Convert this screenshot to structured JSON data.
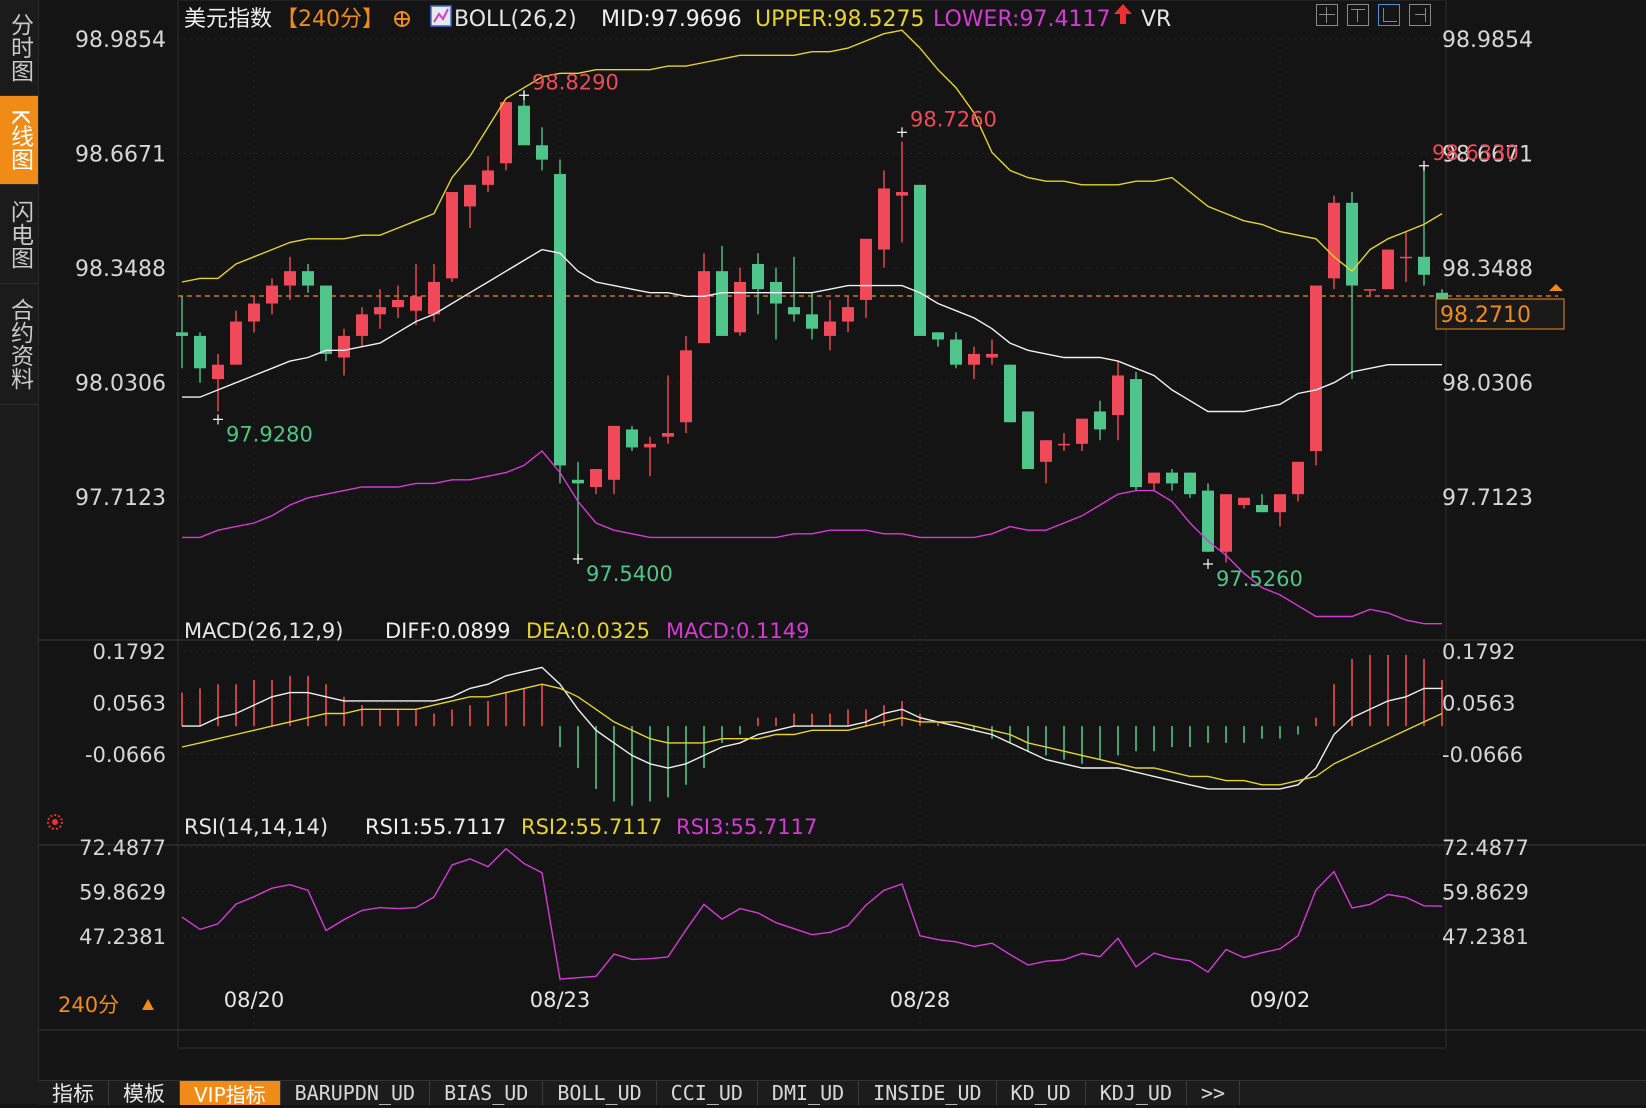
{
  "nav": [
    {
      "label": "分时图",
      "active": false
    },
    {
      "label": "K线图",
      "active": true
    },
    {
      "label": "闪电图",
      "active": false
    },
    {
      "label": "合约资料",
      "active": false
    }
  ],
  "header": {
    "instrument": "美元指数",
    "period": "【240分】",
    "boll": "BOLL(26,2)",
    "mid": "MID:97.9696",
    "upper": "UPPER:98.5275",
    "lower": "LOWER:97.4117",
    "vr": "VR"
  },
  "main_axis": {
    "ticks": [
      "98.9854",
      "98.6671",
      "98.3488",
      "98.0306",
      "97.7123"
    ],
    "tick_values": [
      98.9854,
      98.6671,
      98.3488,
      98.0306,
      97.7123
    ],
    "current_price": "98.2710",
    "current_value": 98.271
  },
  "annotations": [
    {
      "text": "98.8290",
      "kind": "high"
    },
    {
      "text": "98.7260",
      "kind": "high"
    },
    {
      "text": "98.6330",
      "kind": "high"
    },
    {
      "text": "97.9280",
      "kind": "low"
    },
    {
      "text": "97.5400",
      "kind": "low"
    },
    {
      "text": "97.5260",
      "kind": "low"
    }
  ],
  "macd": {
    "label": "MACD(26,12,9)",
    "diff": "DIFF:0.0899",
    "dea": "DEA:0.0325",
    "macd": "MACD:0.1149",
    "ticks": [
      "0.1792",
      "0.0563",
      "-0.0666"
    ],
    "tick_values": [
      0.1792,
      0.0563,
      -0.0666
    ]
  },
  "rsi": {
    "label": "RSI(14,14,14)",
    "rsi1": "RSI1:55.7117",
    "rsi2": "RSI2:55.7117",
    "rsi3": "RSI3:55.7117",
    "ticks": [
      "72.4877",
      "59.8629",
      "47.2381"
    ],
    "tick_values": [
      72.4877,
      59.8629,
      47.2381
    ]
  },
  "x_axis": {
    "period_label": "240分",
    "dates": [
      "08/20",
      "08/23",
      "08/28",
      "09/02"
    ]
  },
  "tabs": [
    "指标",
    "模板",
    "VIP指标",
    "BARUPDN_UD",
    "BIAS_UD",
    "BOLL_UD",
    "CCI_UD",
    "DMI_UD",
    "INSIDE_UD",
    "KD_UD",
    "KDJ_UD",
    ">>"
  ],
  "colors": {
    "up": "#f04a5a",
    "down": "#4fc48b",
    "mid": "#f0f0f0",
    "upper": "#e6d32c",
    "lower": "#d63ad6",
    "accent": "#f08b17",
    "high_label": "#f04a5a",
    "low_label": "#4fc48b"
  },
  "chart_data": {
    "type": "candlestick",
    "candles": [
      [
        98.17,
        98.27,
        98.07,
        98.16
      ],
      [
        98.16,
        98.17,
        98.03,
        98.07
      ],
      [
        98.04,
        98.11,
        97.95,
        98.08
      ],
      [
        98.08,
        98.23,
        98.08,
        98.2
      ],
      [
        98.2,
        98.27,
        98.17,
        98.25
      ],
      [
        98.25,
        98.32,
        98.22,
        98.3
      ],
      [
        98.3,
        98.38,
        98.26,
        98.34
      ],
      [
        98.34,
        98.36,
        98.28,
        98.3
      ],
      [
        98.3,
        98.3,
        98.09,
        98.11
      ],
      [
        98.1,
        98.18,
        98.05,
        98.16
      ],
      [
        98.16,
        98.24,
        98.13,
        98.22
      ],
      [
        98.22,
        98.29,
        98.18,
        98.24
      ],
      [
        98.24,
        98.3,
        98.21,
        98.26
      ],
      [
        98.23,
        98.36,
        98.19,
        98.27
      ],
      [
        98.22,
        98.36,
        98.2,
        98.31
      ],
      [
        98.32,
        98.55,
        98.31,
        98.56
      ],
      [
        98.52,
        98.58,
        98.46,
        98.58
      ],
      [
        98.58,
        98.66,
        98.56,
        98.62
      ],
      [
        98.64,
        98.81,
        98.62,
        98.81
      ],
      [
        98.8,
        98.84,
        98.7,
        98.69
      ],
      [
        98.69,
        98.74,
        98.62,
        98.65
      ],
      [
        98.61,
        98.65,
        97.75,
        97.8
      ],
      [
        97.76,
        97.81,
        97.54,
        97.75
      ],
      [
        97.74,
        97.79,
        97.72,
        97.79
      ],
      [
        97.76,
        97.89,
        97.72,
        97.91
      ],
      [
        97.9,
        97.91,
        97.84,
        97.85
      ],
      [
        97.85,
        97.88,
        97.77,
        97.86
      ],
      [
        97.88,
        98.05,
        97.86,
        97.89
      ],
      [
        97.92,
        98.16,
        97.89,
        98.12
      ],
      [
        98.14,
        98.39,
        98.14,
        98.34
      ],
      [
        98.34,
        98.41,
        98.16,
        98.16
      ],
      [
        98.17,
        98.35,
        98.16,
        98.31
      ],
      [
        98.36,
        98.39,
        98.22,
        98.29
      ],
      [
        98.31,
        98.35,
        98.15,
        98.25
      ],
      [
        98.24,
        98.38,
        98.2,
        98.22
      ],
      [
        98.22,
        98.28,
        98.15,
        98.18
      ],
      [
        98.16,
        98.26,
        98.12,
        98.2
      ],
      [
        98.2,
        98.27,
        98.17,
        98.24
      ],
      [
        98.26,
        98.37,
        98.21,
        98.43
      ],
      [
        98.4,
        98.62,
        98.35,
        98.57
      ],
      [
        98.55,
        98.7,
        98.42,
        98.56
      ],
      [
        98.58,
        98.58,
        98.16,
        98.16
      ],
      [
        98.17,
        98.17,
        98.13,
        98.15
      ],
      [
        98.15,
        98.17,
        98.07,
        98.08
      ],
      [
        98.08,
        98.13,
        98.04,
        98.11
      ],
      [
        98.1,
        98.15,
        98.08,
        98.11
      ],
      [
        98.08,
        98.08,
        97.92,
        97.92
      ],
      [
        97.95,
        97.95,
        97.79,
        97.79
      ],
      [
        97.81,
        97.87,
        97.75,
        97.87
      ],
      [
        97.86,
        97.89,
        97.84,
        97.86
      ],
      [
        97.86,
        97.92,
        97.84,
        97.93
      ],
      [
        97.95,
        97.98,
        97.87,
        97.9
      ],
      [
        97.94,
        98.09,
        97.87,
        98.05
      ],
      [
        98.04,
        98.06,
        97.73,
        97.74
      ],
      [
        97.75,
        97.78,
        97.73,
        97.78
      ],
      [
        97.78,
        97.79,
        97.73,
        97.75
      ],
      [
        97.78,
        97.78,
        97.71,
        97.72
      ],
      [
        97.73,
        97.75,
        97.56,
        97.56
      ],
      [
        97.56,
        97.72,
        97.53,
        97.72
      ],
      [
        97.69,
        97.71,
        97.68,
        97.71
      ],
      [
        97.69,
        97.72,
        97.67,
        97.67
      ],
      [
        97.67,
        97.69,
        97.63,
        97.72
      ],
      [
        97.72,
        97.81,
        97.7,
        97.81
      ],
      [
        97.84,
        98.3,
        97.8,
        98.3
      ],
      [
        98.32,
        98.55,
        98.29,
        98.53
      ],
      [
        98.53,
        98.56,
        98.04,
        98.3
      ],
      [
        98.29,
        98.29,
        98.27,
        98.29
      ],
      [
        98.29,
        98.38,
        98.29,
        98.4
      ],
      [
        98.38,
        98.45,
        98.31,
        98.38
      ],
      [
        98.38,
        98.63,
        98.3,
        98.33
      ],
      [
        98.28,
        98.29,
        98.25,
        98.25
      ]
    ],
    "mid": [
      97.99,
      97.99,
      98.01,
      98.03,
      98.05,
      98.07,
      98.09,
      98.1,
      98.12,
      98.12,
      98.13,
      98.14,
      98.17,
      98.2,
      98.22,
      98.25,
      98.28,
      98.31,
      98.34,
      98.37,
      98.4,
      98.39,
      98.34,
      98.31,
      98.3,
      98.29,
      98.28,
      98.28,
      98.27,
      98.27,
      98.28,
      98.28,
      98.28,
      98.28,
      98.28,
      98.28,
      98.29,
      98.3,
      98.3,
      98.3,
      98.3,
      98.28,
      98.25,
      98.23,
      98.21,
      98.18,
      98.14,
      98.12,
      98.11,
      98.1,
      98.1,
      98.1,
      98.09,
      98.07,
      98.05,
      98.01,
      97.98,
      97.95,
      97.95,
      97.95,
      97.96,
      97.97,
      98.0,
      98.01,
      98.03,
      98.06,
      98.07,
      98.08,
      98.08,
      98.08,
      98.08
    ],
    "upper": [
      98.31,
      98.32,
      98.32,
      98.36,
      98.38,
      98.4,
      98.42,
      98.43,
      98.43,
      98.43,
      98.44,
      98.44,
      98.46,
      98.48,
      98.5,
      98.6,
      98.66,
      98.74,
      98.82,
      98.85,
      98.88,
      98.89,
      98.89,
      98.9,
      98.9,
      98.9,
      98.9,
      98.91,
      98.91,
      98.92,
      98.93,
      98.94,
      98.94,
      98.94,
      98.94,
      98.95,
      98.95,
      98.96,
      98.98,
      99.0,
      99.01,
      98.96,
      98.9,
      98.85,
      98.78,
      98.67,
      98.62,
      98.6,
      98.59,
      98.59,
      98.58,
      98.58,
      98.58,
      98.59,
      98.59,
      98.6,
      98.56,
      98.52,
      98.5,
      98.48,
      98.47,
      98.45,
      98.44,
      98.43,
      98.38,
      98.34,
      98.4,
      98.43,
      98.45,
      98.47,
      98.5
    ],
    "lower": [
      97.6,
      97.6,
      97.62,
      97.63,
      97.64,
      97.66,
      97.69,
      97.71,
      97.72,
      97.73,
      97.74,
      97.74,
      97.74,
      97.75,
      97.75,
      97.76,
      97.76,
      97.77,
      97.78,
      97.8,
      97.84,
      97.78,
      97.7,
      97.64,
      97.62,
      97.61,
      97.6,
      97.6,
      97.6,
      97.6,
      97.6,
      97.6,
      97.6,
      97.6,
      97.61,
      97.61,
      97.62,
      97.62,
      97.62,
      97.61,
      97.61,
      97.6,
      97.6,
      97.6,
      97.6,
      97.61,
      97.63,
      97.62,
      97.62,
      97.64,
      97.66,
      97.69,
      97.72,
      97.73,
      97.73,
      97.7,
      97.64,
      97.59,
      97.55,
      97.5,
      97.46,
      97.44,
      97.41,
      97.38,
      97.38,
      97.38,
      97.4,
      97.39,
      97.37,
      97.36,
      97.36
    ],
    "macd_diff": [
      0.0,
      0.0,
      0.02,
      0.03,
      0.05,
      0.07,
      0.08,
      0.08,
      0.07,
      0.06,
      0.06,
      0.06,
      0.06,
      0.06,
      0.06,
      0.07,
      0.09,
      0.1,
      0.12,
      0.13,
      0.14,
      0.1,
      0.04,
      -0.01,
      -0.04,
      -0.07,
      -0.09,
      -0.1,
      -0.09,
      -0.07,
      -0.05,
      -0.04,
      -0.02,
      -0.01,
      0.0,
      0.0,
      0.0,
      0.0,
      0.01,
      0.03,
      0.04,
      0.02,
      0.01,
      0.0,
      -0.01,
      -0.02,
      -0.04,
      -0.06,
      -0.08,
      -0.09,
      -0.1,
      -0.1,
      -0.1,
      -0.11,
      -0.12,
      -0.13,
      -0.14,
      -0.15,
      -0.15,
      -0.15,
      -0.15,
      -0.15,
      -0.14,
      -0.1,
      -0.02,
      0.02,
      0.04,
      0.06,
      0.07,
      0.09,
      0.09
    ],
    "macd_dea": [
      -0.05,
      -0.04,
      -0.03,
      -0.02,
      -0.01,
      0.0,
      0.01,
      0.02,
      0.03,
      0.03,
      0.04,
      0.04,
      0.04,
      0.04,
      0.05,
      0.06,
      0.07,
      0.07,
      0.08,
      0.09,
      0.1,
      0.09,
      0.07,
      0.04,
      0.01,
      -0.01,
      -0.03,
      -0.04,
      -0.04,
      -0.04,
      -0.03,
      -0.03,
      -0.03,
      -0.02,
      -0.02,
      -0.01,
      -0.01,
      -0.01,
      0.0,
      0.01,
      0.02,
      0.01,
      0.01,
      0.01,
      0.0,
      -0.01,
      -0.02,
      -0.04,
      -0.05,
      -0.06,
      -0.07,
      -0.08,
      -0.09,
      -0.1,
      -0.1,
      -0.11,
      -0.12,
      -0.12,
      -0.13,
      -0.13,
      -0.14,
      -0.14,
      -0.13,
      -0.12,
      -0.09,
      -0.07,
      -0.05,
      -0.03,
      -0.01,
      0.01,
      0.03
    ],
    "macd_hist": [
      0.08,
      0.09,
      0.1,
      0.1,
      0.11,
      0.11,
      0.12,
      0.12,
      0.1,
      0.07,
      0.05,
      0.04,
      0.04,
      0.04,
      0.03,
      0.04,
      0.05,
      0.06,
      0.08,
      0.09,
      0.1,
      -0.05,
      -0.1,
      -0.15,
      -0.18,
      -0.19,
      -0.18,
      -0.17,
      -0.14,
      -0.1,
      -0.04,
      -0.02,
      0.02,
      0.02,
      0.03,
      0.03,
      0.03,
      0.04,
      0.04,
      0.05,
      0.06,
      0.03,
      0.01,
      0.0,
      -0.01,
      -0.03,
      -0.04,
      -0.06,
      -0.07,
      -0.08,
      -0.09,
      -0.08,
      -0.07,
      -0.06,
      -0.06,
      -0.05,
      -0.05,
      -0.04,
      -0.04,
      -0.04,
      -0.03,
      -0.03,
      -0.02,
      0.02,
      0.1,
      0.16,
      0.17,
      0.17,
      0.17,
      0.16,
      0.11
    ],
    "rsi": [
      52.6,
      49.1,
      50.7,
      56.3,
      58.4,
      60.8,
      61.8,
      60.2,
      48.8,
      51.9,
      54.5,
      55.3,
      55.0,
      55.3,
      58.3,
      67.4,
      69.1,
      66.9,
      72.0,
      67.8,
      65.2,
      35.0,
      35.4,
      35.8,
      42.1,
      40.6,
      40.8,
      41.3,
      49.0,
      56.2,
      52.0,
      55.0,
      53.8,
      51.0,
      49.3,
      47.6,
      48.3,
      50.2,
      56.0,
      60.2,
      62.0,
      47.3,
      46.2,
      45.6,
      44.3,
      45.2,
      42.0,
      39.0,
      40.1,
      40.5,
      42.3,
      41.4,
      46.6,
      38.5,
      42.4,
      40.9,
      40.2,
      37.0,
      43.4,
      41.1,
      42.5,
      43.6,
      47.3,
      60.3,
      65.5,
      55.2,
      56.2,
      59.0,
      58.2,
      55.8,
      55.7
    ],
    "x_date_index": [
      4,
      21,
      41,
      61
    ]
  }
}
